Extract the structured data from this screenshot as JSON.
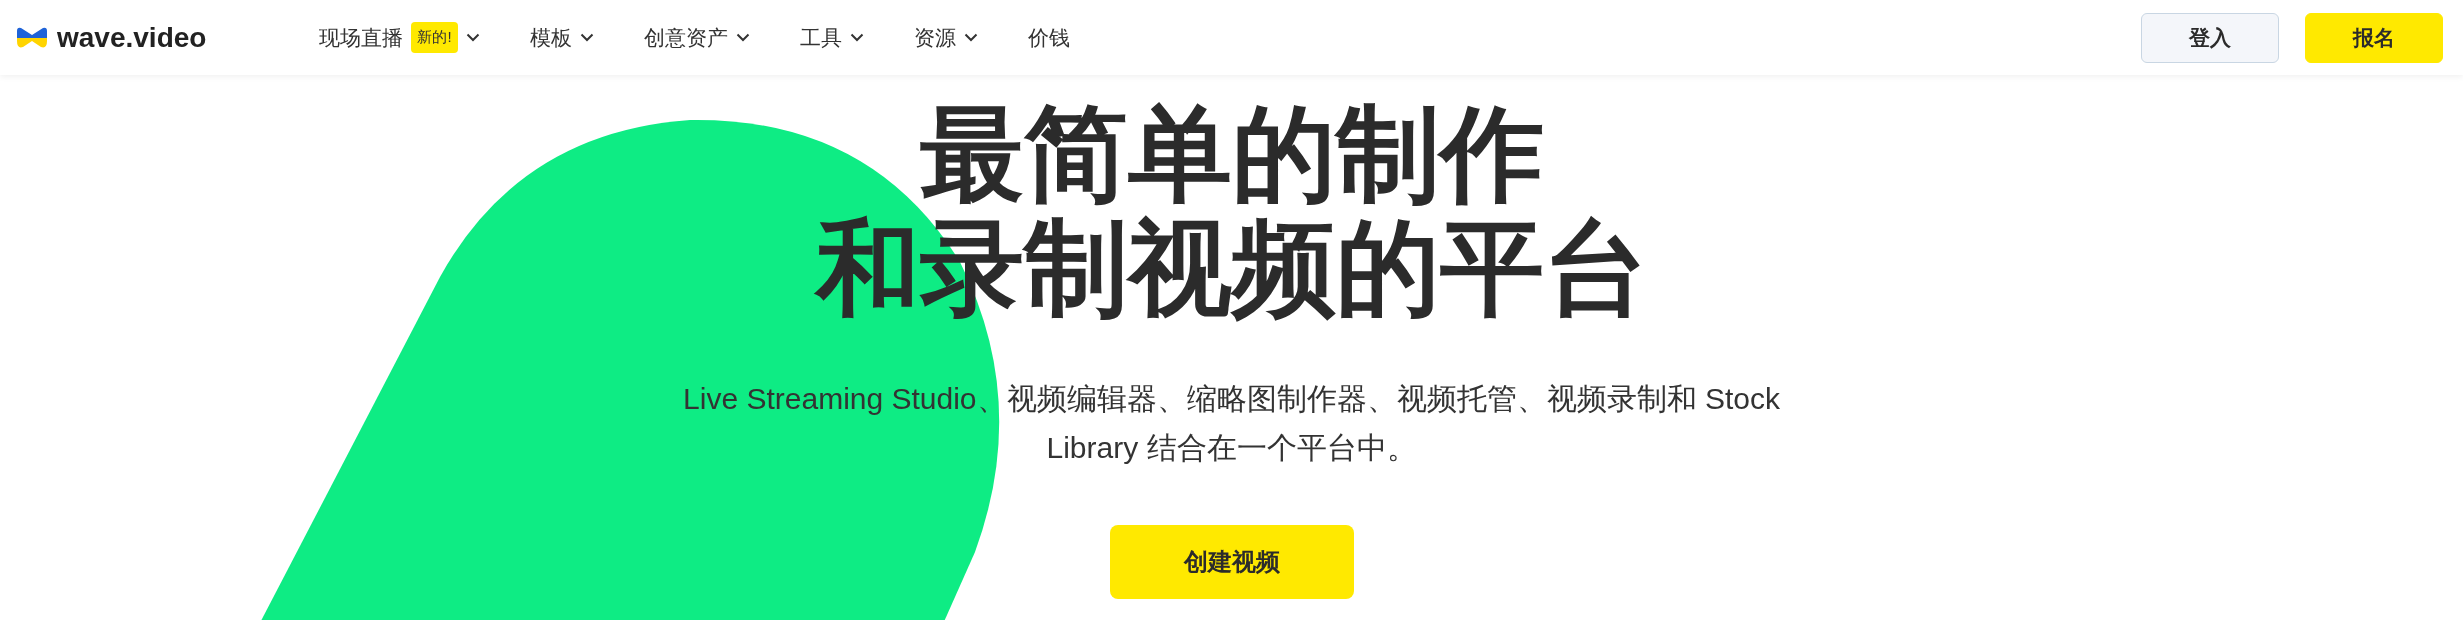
{
  "brand": {
    "name": "wave.video"
  },
  "nav": [
    {
      "label": "现场直播",
      "badge": "新的!",
      "dropdown": true
    },
    {
      "label": "模板",
      "dropdown": true
    },
    {
      "label": "创意资产",
      "dropdown": true
    },
    {
      "label": "工具",
      "dropdown": true
    },
    {
      "label": "资源",
      "dropdown": true
    },
    {
      "label": "价钱",
      "dropdown": false
    }
  ],
  "actions": [
    {
      "label": "登入",
      "kind": "secondary"
    },
    {
      "label": "报名",
      "kind": "primary"
    }
  ],
  "hero": {
    "title_lines": [
      "最简单的制作",
      "和录制视频的平台"
    ],
    "subtitle": "Live Streaming Studio、视频编辑器、缩略图制作器、视频托管、视频录制和 Stock Library 结合在一个平台中。",
    "cta": "创建视频"
  }
}
